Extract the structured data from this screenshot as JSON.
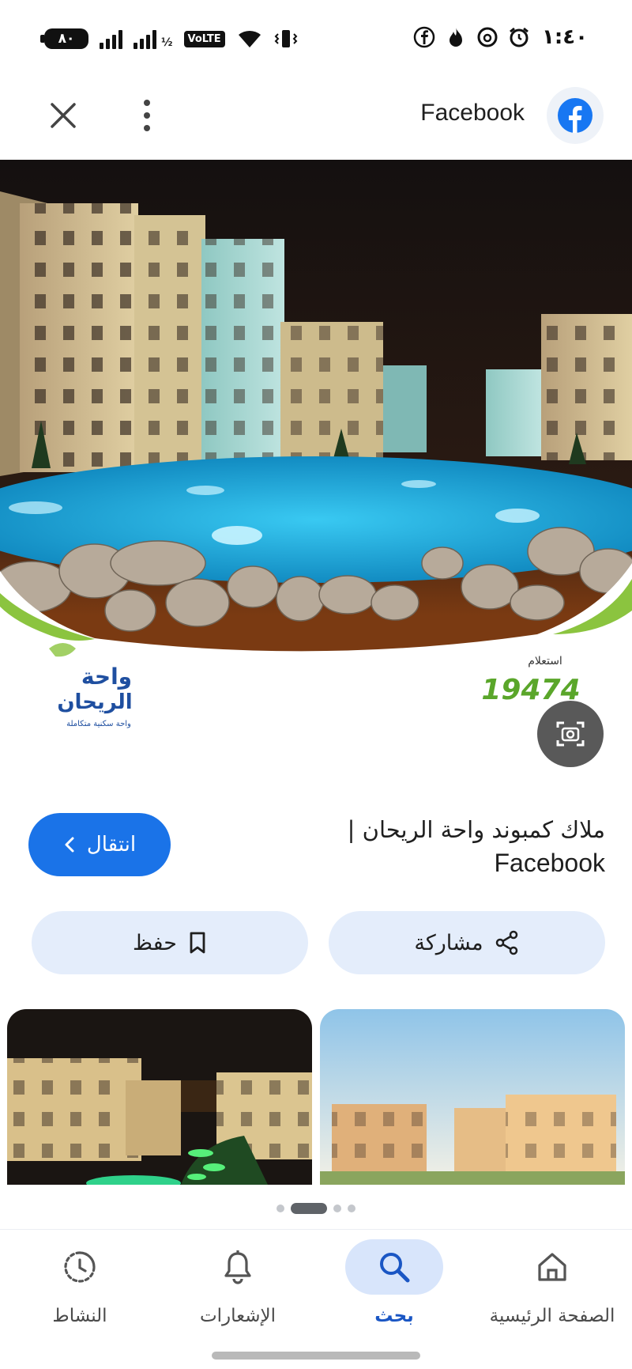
{
  "status_bar": {
    "battery": "٨٠",
    "network_badge": "VoLTE",
    "signal_sim2_label": "½",
    "time": "١:٤٠",
    "icons": [
      "facebook-icon",
      "fire-icon",
      "threads-icon",
      "alarm-icon"
    ]
  },
  "header": {
    "site_name": "Facebook",
    "close_icon": "close-icon",
    "more_icon": "more-vert-icon",
    "logo_icon": "facebook-logo-icon"
  },
  "hero": {
    "hotline": "19474",
    "hotline_caption": "استعلام",
    "brand_line1": "واحة",
    "brand_line2": "الريحان",
    "brand_tagline": "واحة سكنية متكاملة"
  },
  "result": {
    "title_line1": "ملاك كمبوند واحة الريحان |",
    "title_line2": "Facebook",
    "go_label": "انتقال"
  },
  "actions": {
    "save_label": "حفظ",
    "share_label": "مشاركة"
  },
  "pager": {
    "count": 4,
    "active_index": 1
  },
  "bottom_nav": {
    "activity": "النشاط",
    "notifications": "الإشعارات",
    "search": "بحث",
    "home": "الصفحة الرئيسية"
  },
  "colors": {
    "accent": "#1a73e8",
    "chip_bg": "#e4edfb",
    "nav_active_bg": "#d8e5fb",
    "facebook_blue": "#1877f2"
  }
}
